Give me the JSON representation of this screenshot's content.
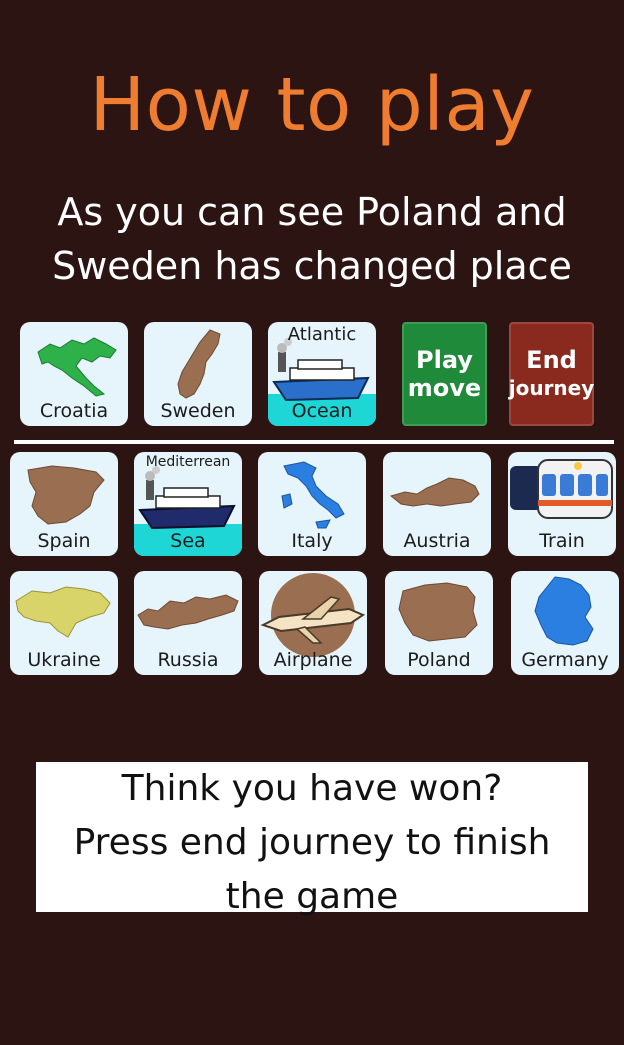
{
  "title": "How to play",
  "subtitle": {
    "line1": "As you can see Poland and",
    "line2": "Sweden has changed place"
  },
  "top_row": [
    {
      "label": "Croatia",
      "color": "#2fb14a"
    },
    {
      "label": "Sweden",
      "color": "#9a6e50"
    },
    {
      "top_label": "Atlantic",
      "label": "Ocean",
      "icon": "ship-icon"
    }
  ],
  "buttons": {
    "play": {
      "line1": "Play",
      "line2": "move",
      "color": "#1e8a3a"
    },
    "end": {
      "line1": "End",
      "line2": "journey",
      "color": "#8a2a1f"
    }
  },
  "board_row1": [
    {
      "label": "Spain",
      "color": "#9a6e50"
    },
    {
      "top_label": "Mediterrean",
      "label": "Sea",
      "icon": "ship-icon"
    },
    {
      "label": "Italy",
      "color": "#2b7fe0"
    },
    {
      "label": "Austria",
      "color": "#9a6e50"
    },
    {
      "label": "Train",
      "icon": "train-icon"
    }
  ],
  "board_row2": [
    {
      "label": "Ukraine",
      "color": "#d9d46a"
    },
    {
      "label": "Russia",
      "color": "#9a6e50"
    },
    {
      "label": "Airplane",
      "icon": "airplane-icon"
    },
    {
      "label": "Poland",
      "color": "#9a6e50"
    },
    {
      "label": "Germany",
      "color": "#2b7fe0"
    }
  ],
  "info": {
    "line1": "Think you have won?",
    "line2": "Press end journey to finish",
    "line3": "the game"
  },
  "colors": {
    "background": "#2b1411",
    "title": "#ee7d30",
    "card": "#e6f4fb",
    "sea": "#1fd6d6"
  }
}
